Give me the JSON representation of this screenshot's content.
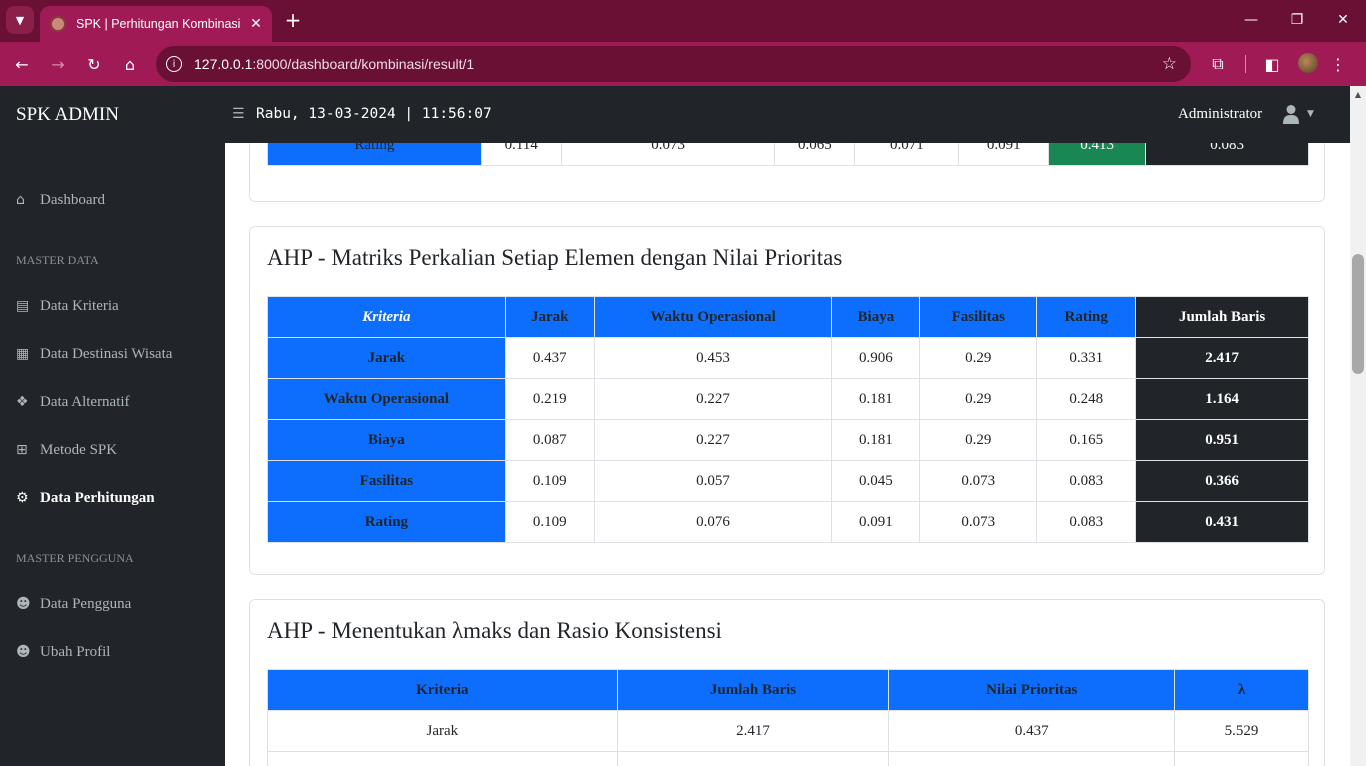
{
  "browser": {
    "tab_list_icon": "chevron-down-icon",
    "tab_title": "SPK | Perhitungan Kombinasi",
    "tab_close": "✕",
    "new_tab": "+",
    "minimize": "—",
    "restore": "❐",
    "close": "✕",
    "url_host": "127.0.0.1",
    "url_rest": ":8000/dashboard/kombinasi/result/1"
  },
  "navbar": {
    "brand": "SPK ADMIN",
    "datetime": "Rabu, 13-03-2024 | 11:56:07",
    "user_name": "Administrator"
  },
  "sidebar": {
    "dashboard": "Dashboard",
    "heading_master_data": "MASTER DATA",
    "data_kriteria": "Data Kriteria",
    "data_destinasi": "Data Destinasi Wisata",
    "data_alternatif": "Data Alternatif",
    "metode_spk": "Metode SPK",
    "data_perhitungan": "Data Perhitungan",
    "heading_master_pengguna": "MASTER PENGGUNA",
    "data_pengguna": "Data Pengguna",
    "ubah_profil": "Ubah Profil"
  },
  "prev_table": {
    "row_label": "Rating",
    "values": [
      "0.114",
      "0.073",
      "0.065",
      "0.071",
      "0.091",
      "0.413",
      "0.083"
    ]
  },
  "matrix_card": {
    "title": "AHP - Matriks Perkalian Setiap Elemen dengan Nilai Prioritas",
    "headers": [
      "Kriteria",
      "Jarak",
      "Waktu Operasional",
      "Biaya",
      "Fasilitas",
      "Rating",
      "Jumlah Baris"
    ],
    "rows": [
      {
        "label": "Jarak",
        "values": [
          "0.437",
          "0.453",
          "0.906",
          "0.29",
          "0.331"
        ],
        "total": "2.417"
      },
      {
        "label": "Waktu Operasional",
        "values": [
          "0.219",
          "0.227",
          "0.181",
          "0.29",
          "0.248"
        ],
        "total": "1.164"
      },
      {
        "label": "Biaya",
        "values": [
          "0.087",
          "0.227",
          "0.181",
          "0.29",
          "0.165"
        ],
        "total": "0.951"
      },
      {
        "label": "Fasilitas",
        "values": [
          "0.109",
          "0.057",
          "0.045",
          "0.073",
          "0.083"
        ],
        "total": "0.366"
      },
      {
        "label": "Rating",
        "values": [
          "0.109",
          "0.076",
          "0.091",
          "0.073",
          "0.083"
        ],
        "total": "0.431"
      }
    ]
  },
  "lambda_card": {
    "title": "AHP - Menentukan λmaks dan Rasio Konsistensi",
    "headers": [
      "Kriteria",
      "Jumlah Baris",
      "Nilai Prioritas",
      "λ"
    ],
    "rows": [
      {
        "kriteria": "Jarak",
        "jumlah": "2.417",
        "prioritas": "0.437",
        "lambda": "5.529"
      }
    ]
  },
  "colors": {
    "browser_frame": "#6a1035",
    "browser_toolbar": "#a01a55",
    "dark": "#212529",
    "primary": "#0d6efd",
    "success": "#198754"
  }
}
